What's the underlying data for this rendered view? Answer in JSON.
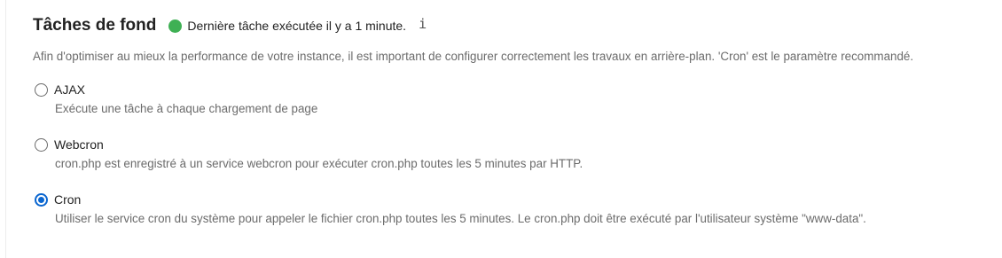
{
  "section": {
    "title": "Tâches de fond",
    "status_text": "Dernière tâche exécutée il y a 1 minute.",
    "status_color": "#3fb054",
    "info_icon": "info-icon",
    "description": "Afin d'optimiser au mieux la performance de votre instance, il est important de configurer correctement les travaux en arrière-plan. 'Cron' est le paramètre recommandé."
  },
  "accent_color": "#0a66d0",
  "options": [
    {
      "label": "AJAX",
      "hint": "Exécute une tâche à chaque chargement de page",
      "selected": false
    },
    {
      "label": "Webcron",
      "hint": "cron.php est enregistré à un service webcron pour exécuter cron.php toutes les 5 minutes par HTTP.",
      "selected": false
    },
    {
      "label": "Cron",
      "hint": "Utiliser le service cron du système pour appeler le fichier cron.php toutes les 5 minutes. Le cron.php doit être exécuté par l'utilisateur système \"www-data\".",
      "selected": true
    }
  ]
}
